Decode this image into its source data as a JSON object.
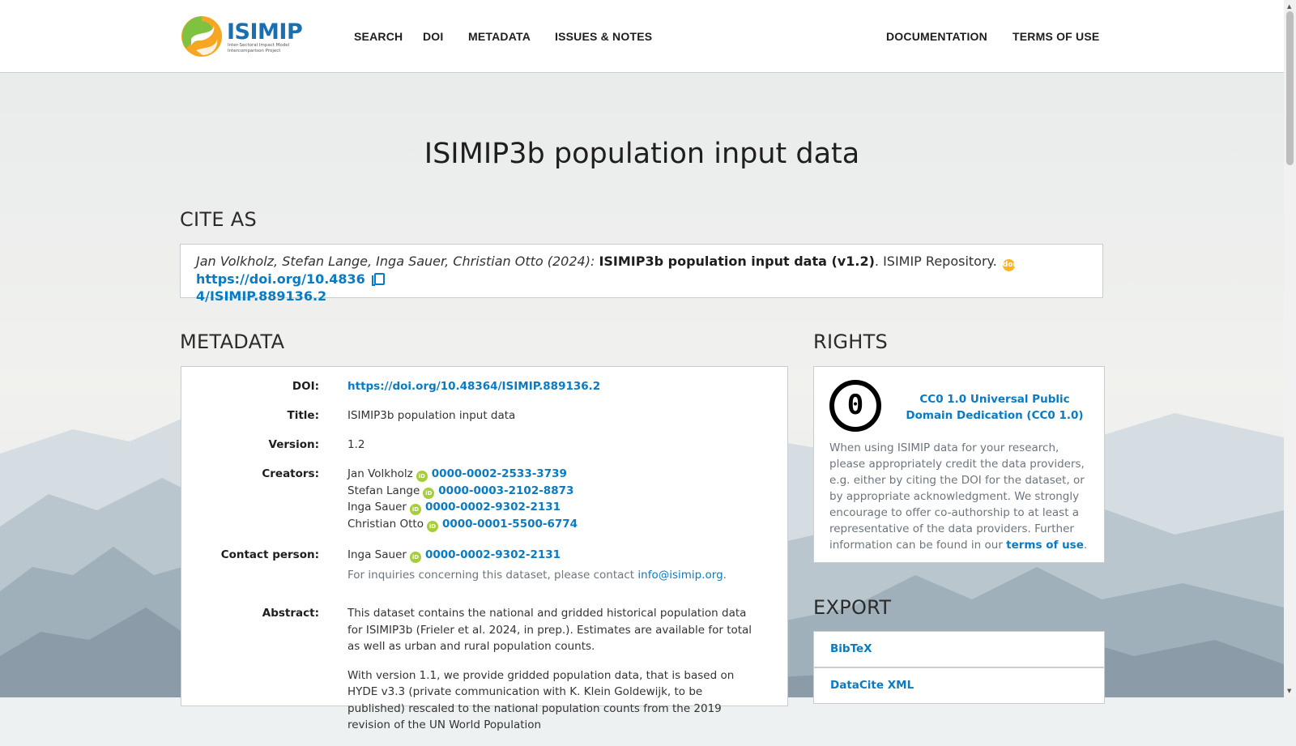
{
  "brand": {
    "name": "ISIMIP",
    "tagline_1": "Inter-Sectoral Impact Model",
    "tagline_2": "Intercomparison Project"
  },
  "nav": {
    "left": [
      "SEARCH",
      "DOI",
      "METADATA",
      "ISSUES & NOTES"
    ],
    "right": [
      "DOCUMENTATION",
      "TERMS OF USE"
    ]
  },
  "page_title": "ISIMIP3b population input data",
  "cite": {
    "heading": "CITE AS",
    "authors": "Jan Volkholz, Stefan Lange, Inga Sauer, Christian Otto (2024):",
    "title": "ISIMIP3b population input data (v1.2)",
    "publisher": ". ISIMIP Repository.",
    "doi_badge": "doi",
    "doi_url_1": "https://doi.org/10.4836",
    "doi_url_2": "4/ISIMIP.889136.2",
    "copy_icon": "copy-icon"
  },
  "metadata": {
    "heading": "METADATA",
    "doi_label": "DOI:",
    "doi_value": "https://doi.org/10.48364/ISIMIP.889136.2",
    "title_label": "Title:",
    "title_value": "ISIMIP3b population input data",
    "version_label": "Version:",
    "version_value": "1.2",
    "creators_label": "Creators:",
    "creators": [
      {
        "name": "Jan Volkholz",
        "orcid": "0000-0002-2533-3739"
      },
      {
        "name": "Stefan Lange",
        "orcid": "0000-0003-2102-8873"
      },
      {
        "name": "Inga Sauer",
        "orcid": "0000-0002-9302-2131"
      },
      {
        "name": "Christian Otto",
        "orcid": "0000-0001-5500-6774"
      }
    ],
    "orcid_badge": "iD",
    "contact_label": "Contact person:",
    "contact": {
      "name": "Inga Sauer",
      "orcid": "0000-0002-9302-2131"
    },
    "contact_note_prefix": "For inquiries concerning this dataset, please contact ",
    "contact_email": "info@isimip.org",
    "contact_note_suffix": ".",
    "abstract_label": "Abstract:",
    "abstract_p1": "This dataset contains the national and gridded historical population data for ISIMIP3b (Frieler et al. 2024, in prep.). Estimates are available for total as well as urban and rural population counts.",
    "abstract_p2": "With version 1.1, we provide gridded population data, that is based on HYDE v3.3 (private communication with K. Klein Goldewijk, to be published) rescaled to the national population counts from the 2019 revision of the UN World Population"
  },
  "rights": {
    "heading": "RIGHTS",
    "cc0_symbol": "0",
    "license_link": "CC0 1.0 Universal Public Domain Dedication (CC0 1.0)",
    "text": "When using ISIMIP data for your research, please appropriately credit the data providers, e.g. either by citing the DOI for the dataset, or by appropriate acknowledgment. We strongly encourage to offer co-authorship to at least a representative of the data providers. Further information can be found in our ",
    "terms_link": "terms of use",
    "text_end": "."
  },
  "export": {
    "heading": "EXPORT",
    "items": [
      "BibTeX",
      "DataCite XML"
    ]
  },
  "colors": {
    "link": "#0a7bc2",
    "orcid": "#a6ce39",
    "doi_badge": "#fcb425",
    "brand_blue": "#1a6fb0",
    "brand_orange": "#f6a623"
  }
}
